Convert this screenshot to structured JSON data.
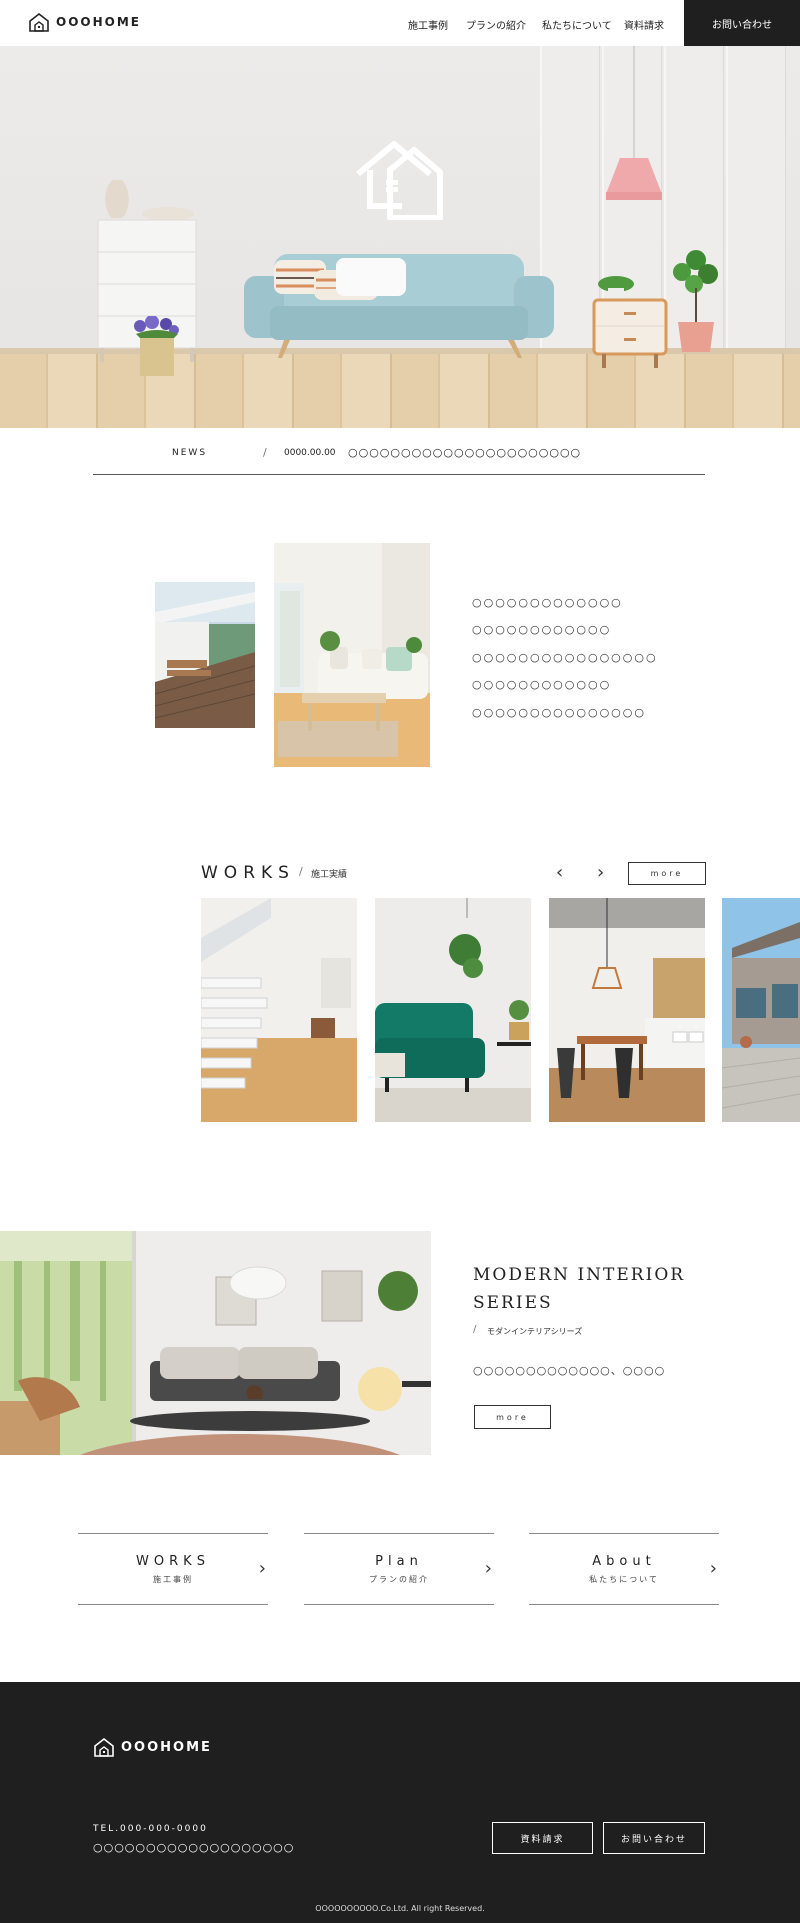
{
  "header": {
    "brand": "OOOHOME",
    "nav": [
      "施工事例",
      "プランの紹介",
      "私たちについて",
      "資料請求"
    ],
    "contact": "お問い合わせ"
  },
  "news": {
    "label": "NEWS",
    "slash": "/",
    "date": "0000.00.00",
    "text": "○○○○○○○○○○○○○○○○○○○○○○"
  },
  "intro": {
    "lines": [
      "○○○○○○○○○○○○○",
      "○○○○○○○○○○○○",
      "○○○○○○○○○○○○○○○○",
      "○○○○○○○○○○○○",
      "○○○○○○○○○○○○○○○"
    ]
  },
  "works": {
    "title": "WORKS",
    "subtitle": "施工実績",
    "slash": "/",
    "more": "more",
    "prev": "‹",
    "next": "›"
  },
  "modern": {
    "title_line1": "MODERN INTERIOR",
    "title_line2": "SERIES",
    "slash": "/",
    "subtitle": "モダンインテリアシリーズ",
    "description": "○○○○○○○○○○○○○、○○○○",
    "more": "more"
  },
  "links": [
    {
      "title": "WORKS",
      "subtitle": "施工事例"
    },
    {
      "title": "Plan",
      "subtitle": "プランの紹介"
    },
    {
      "title": "About",
      "subtitle": "私たちについて"
    }
  ],
  "footer": {
    "brand": "OOOHOME",
    "tel": "TEL.000-000-0000",
    "address": "○○○○○○○○○○○○○○○○○○○",
    "request_button": "資料請求",
    "contact_button": "お問い合わせ",
    "copyright": "OOOOOOOOOO.Co.Ltd. All right Reserved."
  },
  "colors": {
    "dark": "#1f1f1f",
    "sofa": "#9dc4cd",
    "green_sofa": "#137a68",
    "floor": "#e5cfab"
  }
}
